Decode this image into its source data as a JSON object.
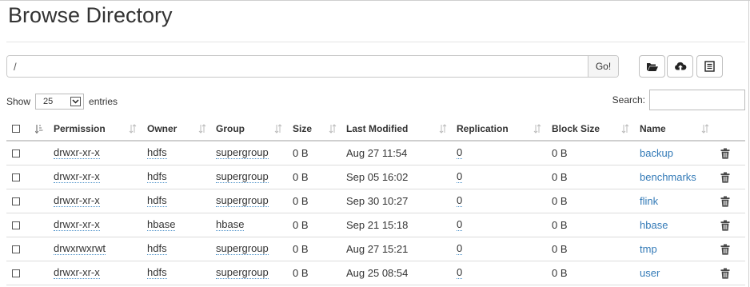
{
  "page": {
    "title": "Browse Directory"
  },
  "pathbar": {
    "value": "/",
    "go_label": "Go!"
  },
  "toolbar": {
    "icons": [
      "folder-open-icon",
      "cloud-upload-icon",
      "list-icon"
    ]
  },
  "entries": {
    "show_label": "Show",
    "selected": "25",
    "suffix_label": "entries"
  },
  "search": {
    "label": "Search:",
    "value": ""
  },
  "table": {
    "columns": [
      "Permission",
      "Owner",
      "Group",
      "Size",
      "Last Modified",
      "Replication",
      "Block Size",
      "Name"
    ],
    "rows": [
      {
        "permission": "drwxr-xr-x",
        "owner": "hdfs",
        "group": "supergroup",
        "size": "0 B",
        "modified": "Aug 27 11:54",
        "replication": "0",
        "block_size": "0 B",
        "name": "backup"
      },
      {
        "permission": "drwxr-xr-x",
        "owner": "hdfs",
        "group": "supergroup",
        "size": "0 B",
        "modified": "Sep 05 16:02",
        "replication": "0",
        "block_size": "0 B",
        "name": "benchmarks"
      },
      {
        "permission": "drwxr-xr-x",
        "owner": "hdfs",
        "group": "supergroup",
        "size": "0 B",
        "modified": "Sep 30 10:27",
        "replication": "0",
        "block_size": "0 B",
        "name": "flink"
      },
      {
        "permission": "drwxr-xr-x",
        "owner": "hbase",
        "group": "hbase",
        "size": "0 B",
        "modified": "Sep 21 15:18",
        "replication": "0",
        "block_size": "0 B",
        "name": "hbase"
      },
      {
        "permission": "drwxrwxrwt",
        "owner": "hdfs",
        "group": "supergroup",
        "size": "0 B",
        "modified": "Aug 27 15:21",
        "replication": "0",
        "block_size": "0 B",
        "name": "tmp"
      },
      {
        "permission": "drwxr-xr-x",
        "owner": "hdfs",
        "group": "supergroup",
        "size": "0 B",
        "modified": "Aug 25 08:54",
        "replication": "0",
        "block_size": "0 B",
        "name": "user"
      }
    ]
  },
  "colors": {
    "link": "#337ab7",
    "text": "#333333",
    "border": "#dcdcdc"
  }
}
